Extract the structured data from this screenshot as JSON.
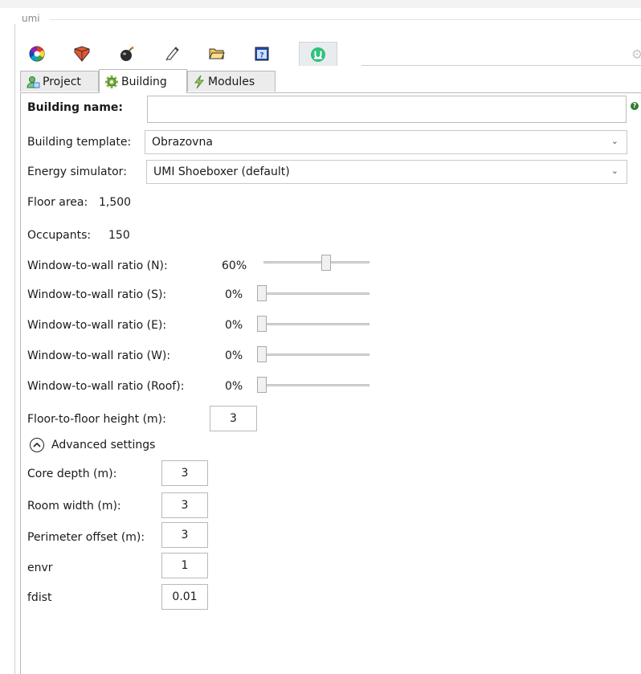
{
  "panel": {
    "title": "umi"
  },
  "toolbar": {
    "icons": [
      "color-wheel-icon",
      "layers-icon",
      "bomb-icon",
      "pencil-icon",
      "folder-icon",
      "help-window-icon",
      "umi-logo-icon"
    ],
    "active_index": 6
  },
  "tabs": {
    "project": "Project",
    "building": "Building",
    "modules": "Modules",
    "selected": "Building"
  },
  "building": {
    "name_label": "Building name:",
    "name_value": "",
    "template_label": "Building template:",
    "template_value": "Obrazovna",
    "simulator_label": "Energy simulator:",
    "simulator_value": "UMI Shoeboxer (default)",
    "floor_area_label": "Floor area:",
    "floor_area_value": "1,500",
    "occupants_label": "Occupants:",
    "occupants_value": "150",
    "wwr": [
      {
        "label": "Window-to-wall ratio (N):",
        "value_text": "60%",
        "value": 0.6
      },
      {
        "label": "Window-to-wall ratio (S):",
        "value_text": "0%",
        "value": 0.0
      },
      {
        "label": "Window-to-wall ratio (E):",
        "value_text": "0%",
        "value": 0.0
      },
      {
        "label": "Window-to-wall ratio (W):",
        "value_text": "0%",
        "value": 0.0
      },
      {
        "label": "Window-to-wall ratio (Roof):",
        "value_text": "0%",
        "value": 0.0
      }
    ],
    "floor_height_label": "Floor-to-floor height (m):",
    "floor_height_value": "3"
  },
  "advanced": {
    "toggle_label": "Advanced settings",
    "core_depth_label": "Core depth (m):",
    "core_depth_value": "3",
    "room_width_label": "Room width (m):",
    "room_width_value": "3",
    "perimeter_offset_label": "Perimeter offset (m):",
    "perimeter_offset_value": "3",
    "envr_label": "envr",
    "envr_value": "1",
    "fdist_label": "fdist",
    "fdist_value": "0.01"
  },
  "colors": {
    "accent_red": "#e4572e",
    "umi_green": "#2ec27e",
    "tab_border": "#b9b9b9"
  }
}
